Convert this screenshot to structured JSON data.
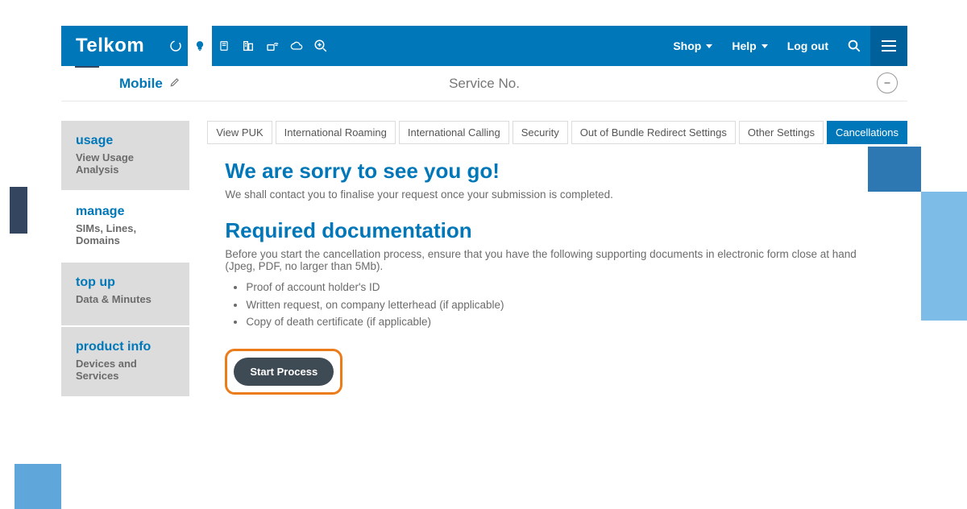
{
  "brand": "Telkom",
  "nav": {
    "shop": "Shop",
    "help": "Help",
    "logout": "Log out"
  },
  "subhead": {
    "title": "Mobile",
    "service_label": "Service No."
  },
  "sidebar": [
    {
      "label": "usage",
      "sub": "View Usage Analysis"
    },
    {
      "label": "manage",
      "sub": "SIMs, Lines, Domains"
    },
    {
      "label": "top up",
      "sub": "Data & Minutes"
    },
    {
      "label": "product info",
      "sub": "Devices and Services"
    }
  ],
  "tabs": [
    "View PUK",
    "International Roaming",
    "International Calling",
    "Security",
    "Out of Bundle Redirect Settings",
    "Other Settings",
    "Cancellations"
  ],
  "cancel": {
    "heading1": "We are sorry to see you go!",
    "lead1": "We shall contact you to finalise your request once your submission is completed.",
    "heading2": "Required documentation",
    "lead2": "Before you start the cancellation process, ensure that you have the following supporting documents in electronic form close at hand (Jpeg, PDF, no larger than 5Mb).",
    "items": [
      "Proof of account holder's ID",
      "Written request, on company letterhead (if applicable)",
      "Copy of death certificate (if applicable)"
    ],
    "start": "Start Process"
  }
}
